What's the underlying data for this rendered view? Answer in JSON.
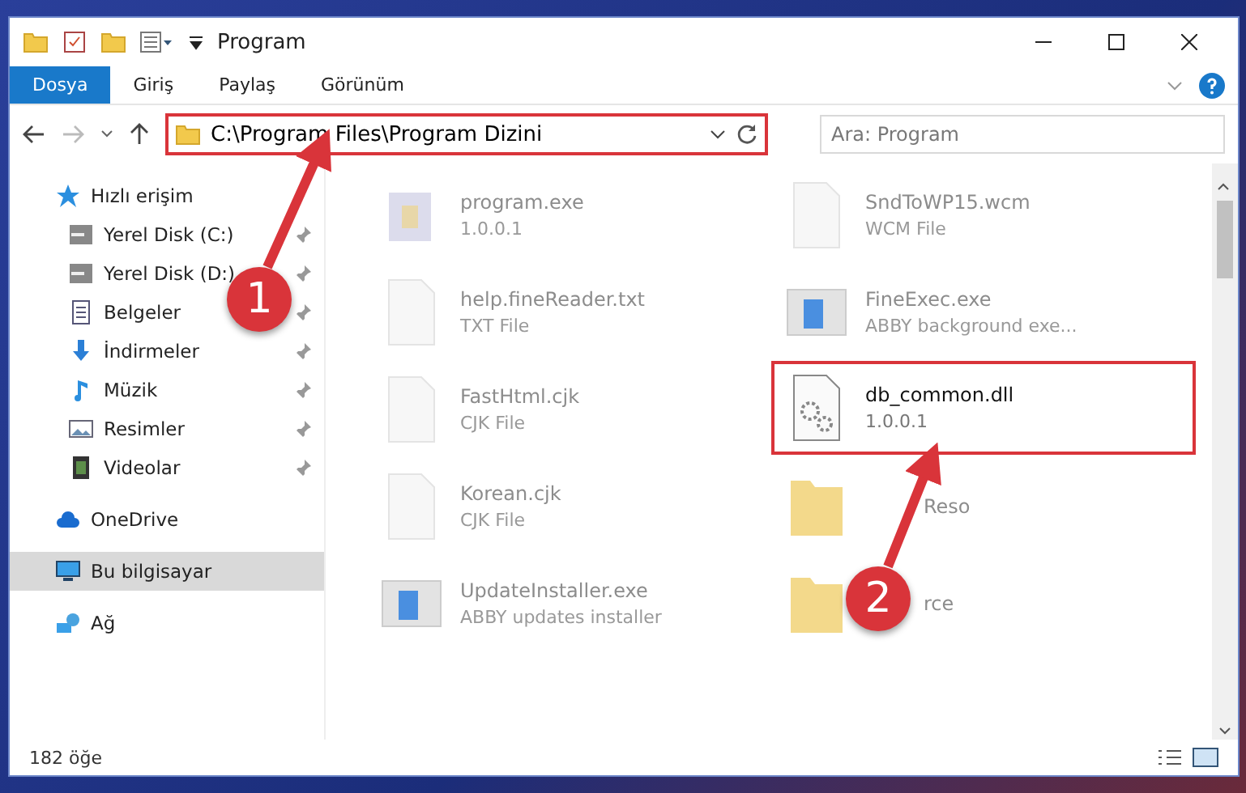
{
  "window": {
    "title": "Program"
  },
  "ribbon_tabs": [
    {
      "label": "Dosya",
      "selected": true
    },
    {
      "label": "Giriş",
      "selected": false
    },
    {
      "label": "Paylaş",
      "selected": false
    },
    {
      "label": "Görünüm",
      "selected": false
    }
  ],
  "address": {
    "path": "C:\\Program Files\\Program Dizini"
  },
  "search": {
    "placeholder": "Ara: Program"
  },
  "sidebar": {
    "items": [
      {
        "label": "Hızlı erişim",
        "pinned": false,
        "selected": false,
        "children": [
          {
            "label": "Yerel Disk (C:)",
            "pinned": true,
            "selected": false
          },
          {
            "label": "Yerel Disk (D:)",
            "pinned": true,
            "selected": false
          },
          {
            "label": "Belgeler",
            "pinned": true,
            "selected": false
          },
          {
            "label": "İndirmeler",
            "pinned": true,
            "selected": false
          },
          {
            "label": "Müzik",
            "pinned": true,
            "selected": false
          },
          {
            "label": "Resimler",
            "pinned": true,
            "selected": false
          },
          {
            "label": "Videolar",
            "pinned": true,
            "selected": false
          }
        ]
      },
      {
        "label": "OneDrive",
        "pinned": false,
        "selected": false
      },
      {
        "label": "Bu bilgisayar",
        "pinned": false,
        "selected": true
      },
      {
        "label": "Ağ",
        "pinned": false,
        "selected": false
      }
    ]
  },
  "files": [
    {
      "name": "program.exe",
      "detail": "1.0.0.1",
      "kind": "app",
      "highlighted": false
    },
    {
      "name": "SndToWP15.wcm",
      "detail": "WCM File",
      "kind": "file",
      "highlighted": false
    },
    {
      "name": "help.fineReader.txt",
      "detail": "TXT File",
      "kind": "file",
      "highlighted": false
    },
    {
      "name": "FineExec.exe",
      "detail": "ABBY background exe...",
      "kind": "window",
      "highlighted": false
    },
    {
      "name": "FastHtml.cjk",
      "detail": "CJK File",
      "kind": "file",
      "highlighted": false
    },
    {
      "name": "db_common.dll",
      "detail": "1.0.0.1",
      "kind": "dll",
      "highlighted": true
    },
    {
      "name": "Korean.cjk",
      "detail": "CJK File",
      "kind": "file",
      "highlighted": false
    },
    {
      "name": "Reso",
      "kind": "folder",
      "highlighted": false
    },
    {
      "name": "UpdateInstaller.exe",
      "detail": "ABBY updates installer",
      "kind": "window",
      "highlighted": false
    },
    {
      "name": "rce",
      "kind": "folder",
      "highlighted": false
    }
  ],
  "status_bar": {
    "count": "182 öğe"
  },
  "annotations": [
    {
      "label": "1"
    },
    {
      "label": "2"
    }
  ]
}
